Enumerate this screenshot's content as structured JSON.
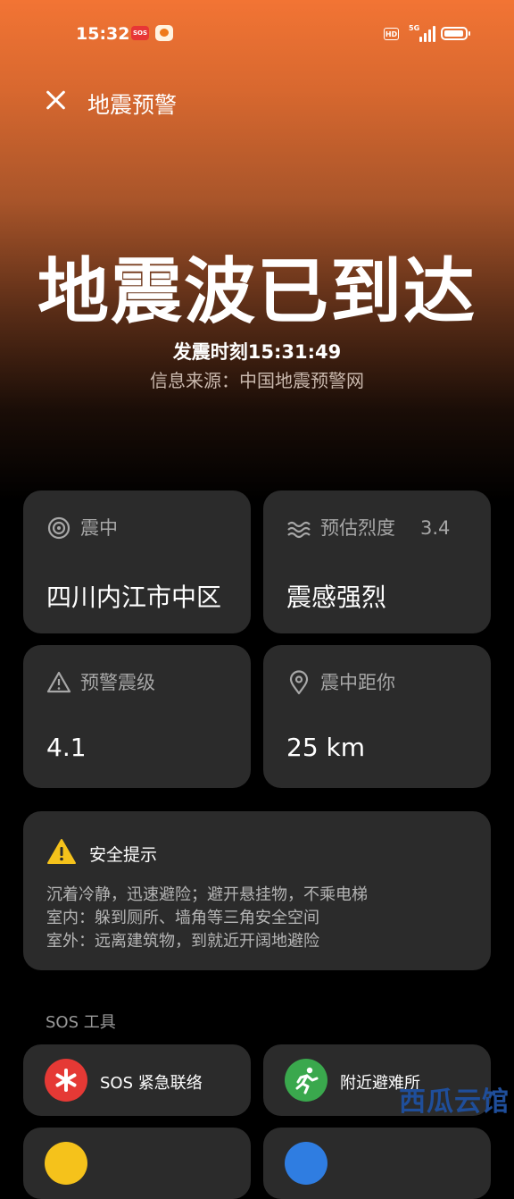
{
  "status_bar": {
    "time": "15:32",
    "sos_badge": "SOS",
    "network": "5G",
    "hd": "HD"
  },
  "header": {
    "title": "地震预警"
  },
  "hero": {
    "title": "地震波已到达",
    "quake_time": "发震时刻15:31:49",
    "source": "信息来源：中国地震预警网"
  },
  "cards": {
    "epicenter": {
      "label": "震中",
      "value": "四川内江市中区",
      "icon": "target-icon"
    },
    "intensity": {
      "label": "预估烈度",
      "aux": "3.4",
      "value": "震感强烈",
      "icon": "waves-icon"
    },
    "magnitude": {
      "label": "预警震级",
      "value": "4.1",
      "icon": "warning-triangle-icon"
    },
    "distance": {
      "label": "震中距你",
      "value": "25 km",
      "icon": "location-pin-icon"
    }
  },
  "tips": {
    "title": "安全提示",
    "lines": [
      "沉着冷静，迅速避险；避开悬挂物，不乘电梯",
      "室内：躲到厕所、墙角等三角安全空间",
      "室外：远离建筑物，到就近开阔地避险"
    ]
  },
  "sos_tools": {
    "section_label": "SOS 工具",
    "items": [
      {
        "label": "SOS 紧急联络",
        "icon": "asterisk-icon",
        "color": "#e53935"
      },
      {
        "label": "附近避难所",
        "icon": "running-person-icon",
        "color": "#3aa84d"
      }
    ]
  },
  "watermark": "西瓜云馆",
  "colors": {
    "card_bg": "#2b2b2b",
    "accent_orange": "#f27434",
    "warning_yellow": "#f5c21b"
  }
}
